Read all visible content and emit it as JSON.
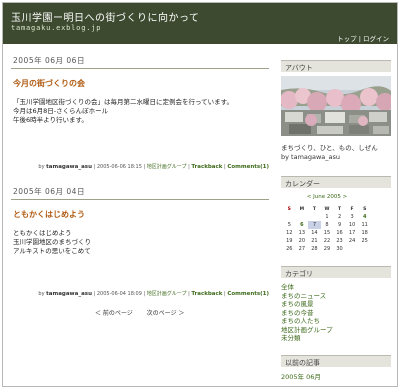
{
  "header": {
    "title": "玉川学園ー明日への街づくりに向かって",
    "url": "tamagaku.exblog.jp",
    "nav_top": "トップ",
    "nav_sep": "|",
    "nav_login": "ログイン"
  },
  "entries": [
    {
      "date": "2005年 06月 06日",
      "title": "今月の街づくりの会",
      "body": [
        "「玉川学園地区街づくりの会」は毎月第二水曜日に定例会を行っています。",
        "今月は6月8日-さくらんぼホール",
        "午後6時半より行います。"
      ],
      "footer_by": "by",
      "footer_author": "tamagawa_asu",
      "footer_date": "| 2005-06-06 18:15 |",
      "footer_category": "地区計画グループ",
      "footer_sep1": "|",
      "footer_trackback": "Trackback",
      "footer_sep2": "|",
      "footer_comments": "Comments(1)"
    },
    {
      "date": "2005年 06月 04日",
      "title": "ともかくはじめよう",
      "body": [
        "ともかくはじめよう",
        "玉川学園地区のまちづくり",
        "アルキストの思いをこめて"
      ],
      "footer_by": "by",
      "footer_author": "tamagawa_asu",
      "footer_date": "| 2005-06-04 18:09 |",
      "footer_category": "地区計画グループ",
      "footer_sep1": "|",
      "footer_trackback": "Trackback",
      "footer_sep2": "|",
      "footer_comments": "Comments(1)"
    }
  ],
  "pager": {
    "prev": "＜ 前のページ",
    "next": "次のページ ＞"
  },
  "sidebar": {
    "about_heading": "アバウト",
    "about_text": "まちづくり、ひと、もの、しぜん",
    "about_by": "by tamagawa_asu",
    "calendar_heading": "カレンダー",
    "calendar_month": "< June 2005 >",
    "calendar_days": [
      "S",
      "M",
      "T",
      "W",
      "T",
      "F",
      "S"
    ],
    "calendar_weeks": [
      [
        "",
        "",
        "",
        "1",
        "2",
        "3",
        "4"
      ],
      [
        "5",
        "6",
        "7",
        "8",
        "9",
        "10",
        "11"
      ],
      [
        "12",
        "13",
        "14",
        "15",
        "16",
        "17",
        "18"
      ],
      [
        "19",
        "20",
        "21",
        "22",
        "23",
        "24",
        "25"
      ],
      [
        "26",
        "27",
        "28",
        "29",
        "30",
        "",
        ""
      ]
    ],
    "category_heading": "カテゴリ",
    "categories": [
      "全体",
      "まちのニュース",
      "まちの風景",
      "まちの今昔",
      "まちの人たち",
      "地区計画グループ",
      "未分類"
    ],
    "archive_heading": "以前の記事",
    "archive_item": "2005年 06月"
  },
  "colors": {
    "header_bg": "#3d4a30",
    "title_accent": "#b05a10",
    "link_green": "#3c6a1a"
  }
}
